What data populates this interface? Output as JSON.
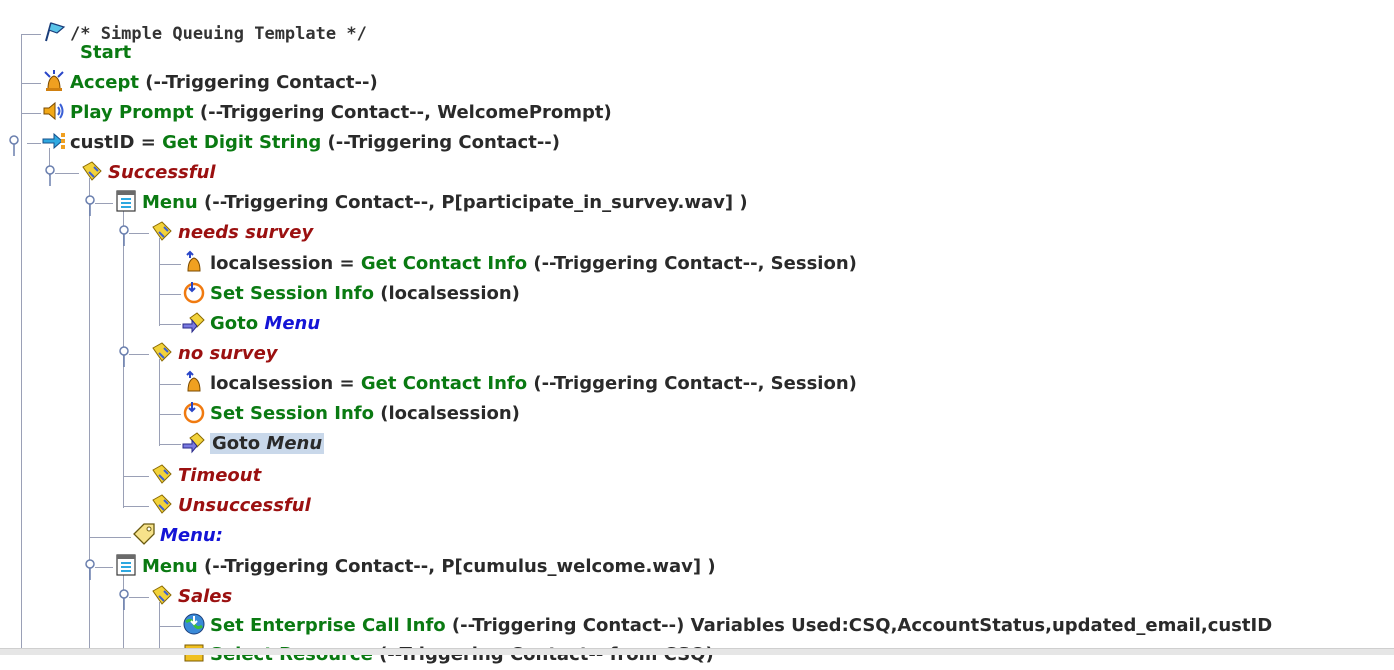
{
  "steps": {
    "comment": "/* Simple Queuing Template */",
    "start": "Start",
    "accept": {
      "kw": "Accept",
      "args": " (--Triggering Contact--)"
    },
    "play": {
      "kw": "Play Prompt",
      "args": " (--Triggering Contact--, WelcomePrompt)"
    },
    "digit": {
      "pre": "custID = ",
      "kw": "Get Digit String",
      "args": " (--Triggering Contact--)"
    },
    "successful": "Successful",
    "menu1": {
      "kw": "Menu",
      "args": " (--Triggering Contact--, P[participate_in_survey.wav] )"
    },
    "needs_survey": "needs survey",
    "gci": {
      "pre": "localsession = ",
      "kw": "Get Contact Info",
      "args": " (--Triggering Contact--, Session)"
    },
    "ssi": {
      "kw": "Set Session Info",
      "args": " (localsession)"
    },
    "goto": {
      "kw": "Goto",
      "label": "Menu"
    },
    "no_survey": "no survey",
    "timeout": "Timeout",
    "unsuccessful": "Unsuccessful",
    "menu_label": "Menu:",
    "menu2": {
      "kw": "Menu",
      "args": " (--Triggering Contact--, P[cumulus_welcome.wav] )"
    },
    "sales": "Sales",
    "seci": {
      "kw": "Set Enterprise Call Info",
      "args": " (--Triggering Contact--) Variables Used:CSQ,AccountStatus,updated_email,custID"
    },
    "select": {
      "kw": "Select Resource",
      "args": " (--Triggering Contact-- from CSQ)"
    }
  },
  "icons": {
    "comment": "comment-flag-icon",
    "accept": "accept-bell-icon",
    "play": "speaker-icon",
    "digit": "digit-string-icon",
    "branch": "branch-tag-icon",
    "menu": "menu-icon",
    "gci": "get-contact-info-icon",
    "ssi": "set-session-info-icon",
    "goto": "goto-icon",
    "label": "label-tag-icon",
    "seci": "enterprise-globe-icon"
  },
  "colors": {
    "keyword": "#0a7a12",
    "branch": "#9b1010",
    "label": "#1414d6",
    "selection": "#c9d8ea",
    "tree_line": "#9aa0b6"
  }
}
